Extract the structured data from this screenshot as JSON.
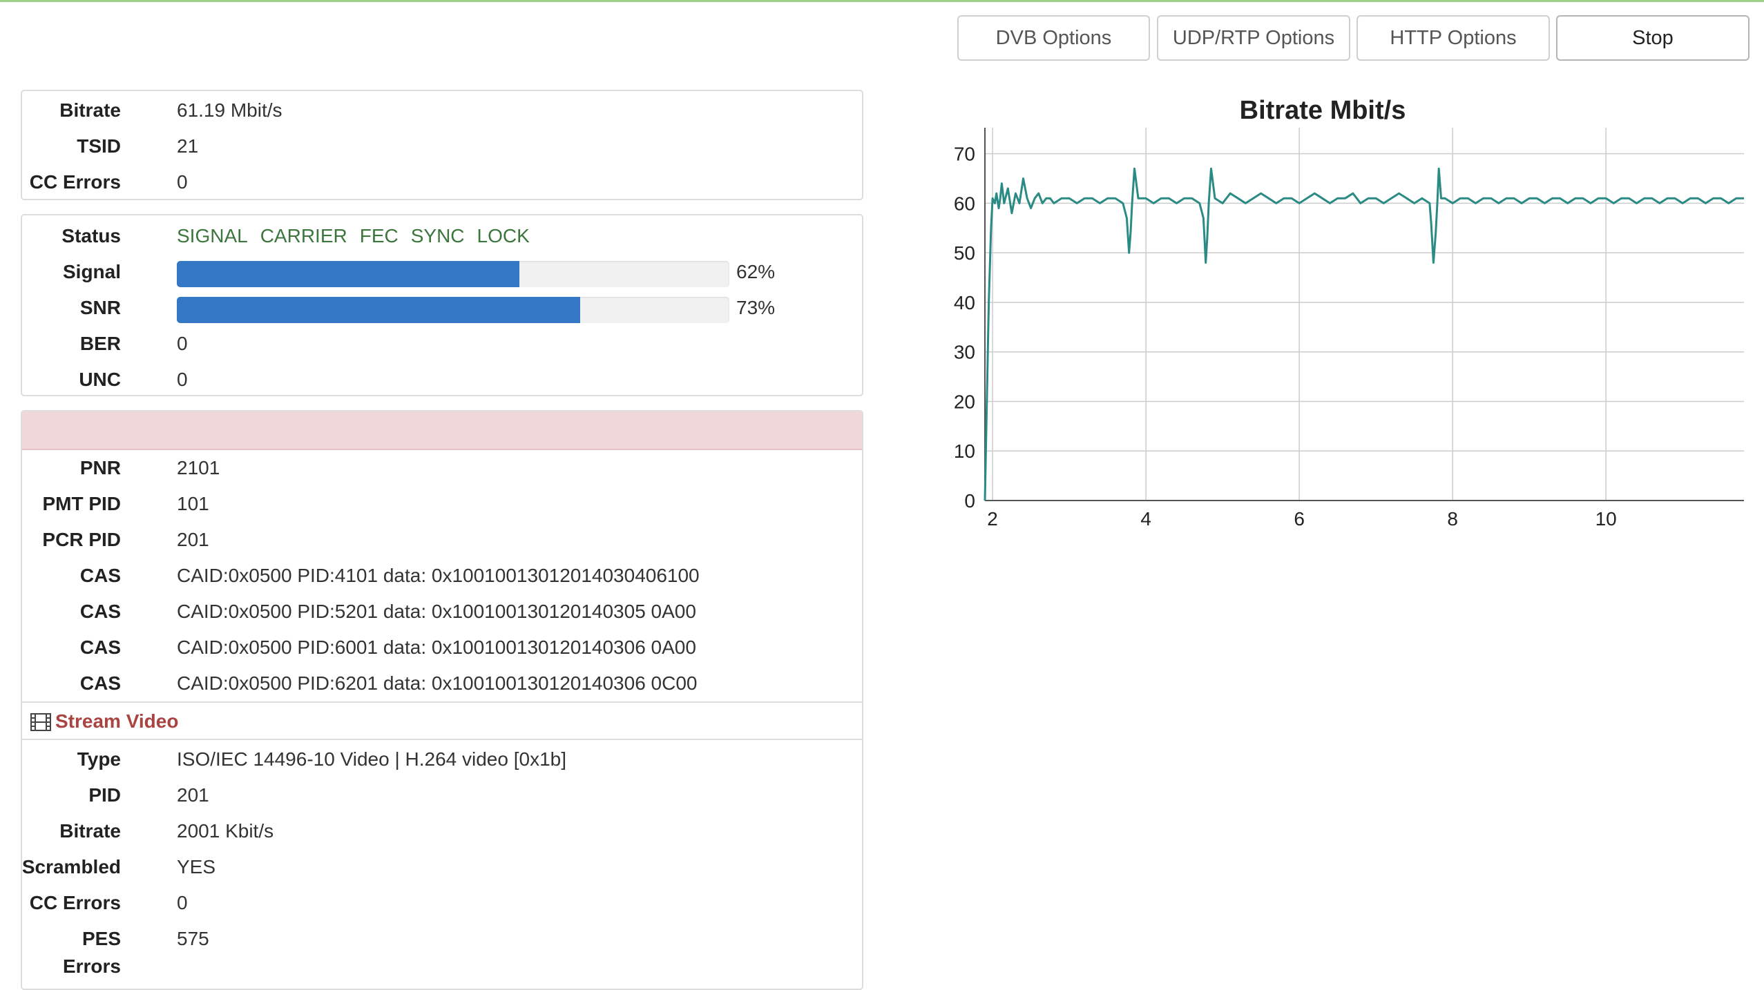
{
  "toolbar": {
    "dvb_label": "DVB Options",
    "udp_label": "UDP/RTP Options",
    "http_label": "HTTP Options",
    "stop_label": "Stop"
  },
  "summary": {
    "bitrate_label": "Bitrate",
    "bitrate_value": "61.19 Mbit/s",
    "tsid_label": "TSID",
    "tsid_value": "21",
    "cc_label": "CC Errors",
    "cc_value": "0"
  },
  "signal": {
    "status_label": "Status",
    "status_words": [
      "SIGNAL",
      "CARRIER",
      "FEC",
      "SYNC",
      "LOCK"
    ],
    "signal_label": "Signal",
    "signal_percent": 62,
    "signal_text": "62%",
    "snr_label": "SNR",
    "snr_percent": 73,
    "snr_text": "73%",
    "ber_label": "BER",
    "ber_value": "0",
    "unc_label": "UNC",
    "unc_value": "0",
    "status_color": "#3c763d",
    "bar_color": "#3477c4"
  },
  "program": {
    "alert_color": "#f0d8da",
    "pnr_label": "PNR",
    "pnr_value": "2101",
    "pmt_label": "PMT PID",
    "pmt_value": "101",
    "pcr_label": "PCR PID",
    "pcr_value": "201",
    "cas": [
      {
        "label": "CAS",
        "value": "CAID:0x0500 PID:4101 data: 0x10010013012014030406100"
      },
      {
        "label": "CAS",
        "value": "CAID:0x0500 PID:5201 data: 0x100100130120140305 0A00"
      },
      {
        "label": "CAS",
        "value": "CAID:0x0500 PID:6001 data: 0x100100130120140306 0A00"
      },
      {
        "label": "CAS",
        "value": "CAID:0x0500 PID:6201 data: 0x100100130120140306 0C00"
      }
    ]
  },
  "stream": {
    "icon": "film-icon",
    "title": "Stream Video",
    "title_color": "#a94442",
    "type_label": "Type",
    "type_value": "ISO/IEC 14496-10 Video | H.264 video [0x1b]",
    "pid_label": "PID",
    "pid_value": "201",
    "bitrate_label": "Bitrate",
    "bitrate_value": "2001 Kbit/s",
    "scrambled_label": "Scrambled",
    "scrambled_value": "YES",
    "cc_label": "CC Errors",
    "cc_value": "0",
    "pes_label_1": "PES",
    "pes_label_2": "Errors",
    "pes_value": "575"
  },
  "chart_data": {
    "type": "line",
    "title": "Bitrate Mbit/s",
    "xlabel": "",
    "ylabel": "",
    "xlim": [
      1.9,
      11.8
    ],
    "ylim": [
      0,
      70
    ],
    "x_ticks": [
      2,
      4,
      6,
      8,
      10
    ],
    "y_ticks": [
      0,
      10,
      20,
      30,
      40,
      50,
      60,
      70
    ],
    "grid": true,
    "line_color": "#2a8a84",
    "series": [
      {
        "values_x": [
          1.9,
          1.95,
          1.98,
          2.0,
          2.03,
          2.05,
          2.08,
          2.1,
          2.12,
          2.15,
          2.2,
          2.25,
          2.3,
          2.35,
          2.4,
          2.45,
          2.5,
          2.55,
          2.6,
          2.65,
          2.7,
          2.75,
          2.8,
          2.9,
          3.0,
          3.1,
          3.2,
          3.3,
          3.4,
          3.5,
          3.6,
          3.7,
          3.75,
          3.78,
          3.8,
          3.82,
          3.85,
          3.9,
          4.0,
          4.1,
          4.2,
          4.3,
          4.4,
          4.5,
          4.6,
          4.7,
          4.75,
          4.78,
          4.8,
          4.82,
          4.85,
          4.9,
          5.0,
          5.1,
          5.2,
          5.3,
          5.4,
          5.5,
          5.6,
          5.7,
          5.8,
          5.9,
          6.0,
          6.1,
          6.2,
          6.3,
          6.4,
          6.5,
          6.6,
          6.7,
          6.8,
          6.9,
          7.0,
          7.1,
          7.2,
          7.3,
          7.4,
          7.5,
          7.6,
          7.7,
          7.72,
          7.75,
          7.78,
          7.8,
          7.82,
          7.85,
          7.9,
          8.0,
          8.1,
          8.2,
          8.3,
          8.4,
          8.5,
          8.6,
          8.7,
          8.8,
          8.9,
          9.0,
          9.1,
          9.2,
          9.3,
          9.4,
          9.5,
          9.6,
          9.7,
          9.8,
          9.9,
          10.0,
          10.1,
          10.2,
          10.3,
          10.4,
          10.5,
          10.6,
          10.7,
          10.8,
          10.9,
          11.0,
          11.1,
          11.2,
          11.3,
          11.4,
          11.5,
          11.6,
          11.7,
          11.8
        ],
        "values_y": [
          0,
          40,
          55,
          61,
          60,
          62,
          59,
          61,
          64,
          60,
          63,
          58,
          62,
          60,
          65,
          61,
          59,
          61,
          62,
          60,
          61,
          61,
          60,
          61,
          61,
          60,
          61,
          61,
          60,
          61,
          61,
          60,
          57,
          50,
          54,
          60,
          67,
          61,
          61,
          60,
          61,
          61,
          60,
          61,
          61,
          60,
          57,
          48,
          53,
          60,
          67,
          61,
          60,
          62,
          61,
          60,
          61,
          62,
          61,
          60,
          61,
          61,
          60,
          61,
          62,
          61,
          60,
          61,
          61,
          62,
          60,
          61,
          61,
          60,
          61,
          62,
          61,
          60,
          61,
          60,
          56,
          48,
          54,
          60,
          67,
          61,
          61,
          60,
          61,
          61,
          60,
          61,
          61,
          60,
          61,
          61,
          60,
          61,
          61,
          60,
          61,
          61,
          60,
          61,
          61,
          60,
          61,
          61,
          60,
          61,
          61,
          60,
          61,
          61,
          60,
          61,
          61,
          60,
          61,
          61,
          60,
          61,
          61,
          60,
          61,
          61
        ]
      }
    ]
  }
}
